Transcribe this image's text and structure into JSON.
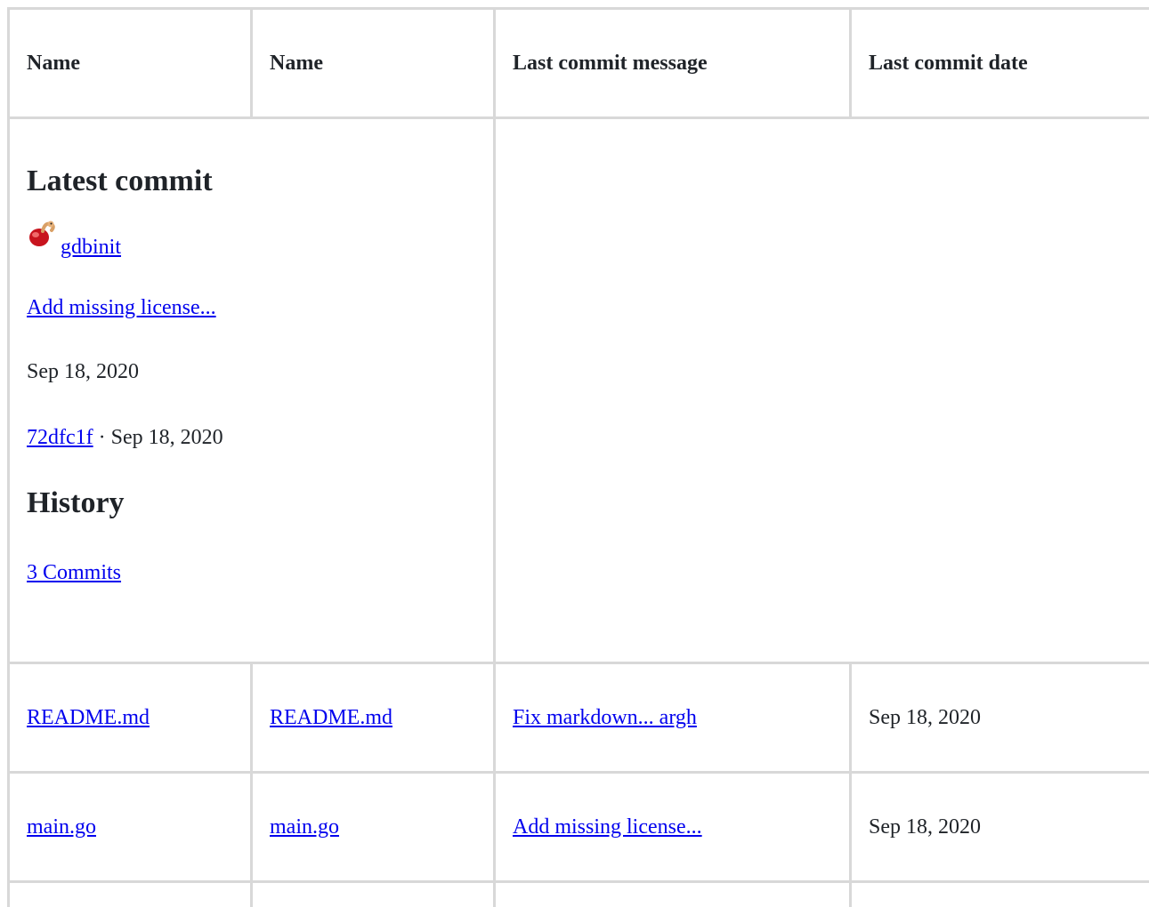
{
  "table": {
    "headers": [
      "Name",
      "Name",
      "Last commit message",
      "Last commit date"
    ]
  },
  "latest_commit": {
    "heading": "Latest commit",
    "author": "gdbinit",
    "message": "Add missing license...",
    "date": "Sep 18, 2020",
    "sha": "72dfc1f",
    "sha_separator": "·",
    "sha_date": "Sep 18, 2020"
  },
  "history": {
    "heading": "History",
    "commits_link": "3 Commits"
  },
  "files": [
    {
      "name": "README.md",
      "name_alt": "README.md",
      "message": "Fix markdown... argh",
      "date": "Sep 18, 2020"
    },
    {
      "name": "main.go",
      "name_alt": "main.go",
      "message": "Add missing license...",
      "date": "Sep 18, 2020"
    }
  ],
  "colors": {
    "link": "#0000ee",
    "border": "#d8d8d8",
    "text": "#1f2328"
  },
  "icons": {
    "avatar": "red-worm-avatar-icon"
  }
}
